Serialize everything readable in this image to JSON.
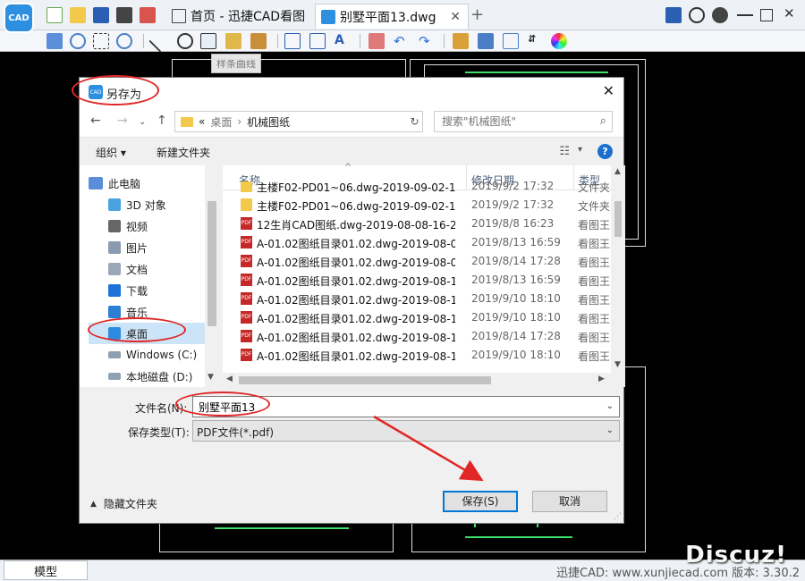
{
  "app": {
    "logo_text": "CAD",
    "tabs": [
      {
        "label": "首页 - 迅捷CAD看图"
      },
      {
        "label": "别墅平面13.dwg"
      }
    ],
    "tab_close": "✕",
    "tab_add": "+",
    "tooltip": "样条曲线"
  },
  "dialog": {
    "title": "另存为",
    "close": "✕",
    "breadcrumb": [
      "«",
      "桌面",
      "机械图纸"
    ],
    "search_placeholder": "搜索\"机械图纸\"",
    "organize": "组织 ▾",
    "new_folder": "新建文件夹",
    "help": "?",
    "nav_items": [
      {
        "label": "此电脑",
        "icon": "computer-icon",
        "color": "#5a8ed8"
      },
      {
        "label": "3D 对象",
        "icon": "cube-icon",
        "color": "#4aa3df"
      },
      {
        "label": "视频",
        "icon": "video-icon",
        "color": "#666666"
      },
      {
        "label": "图片",
        "icon": "picture-icon",
        "color": "#8a9bb0"
      },
      {
        "label": "文档",
        "icon": "document-icon",
        "color": "#9aa7b6"
      },
      {
        "label": "下载",
        "icon": "download-icon",
        "color": "#1e73d8"
      },
      {
        "label": "音乐",
        "icon": "music-icon",
        "color": "#2d7fd6"
      },
      {
        "label": "桌面",
        "icon": "desktop-icon",
        "color": "#2d8ce0",
        "selected": true
      },
      {
        "label": "Windows (C:)",
        "icon": "drive-icon",
        "color": "#8fa0b2"
      },
      {
        "label": "本地磁盘 (D:)",
        "icon": "drive-icon",
        "color": "#8fa0b2"
      }
    ],
    "columns": [
      "名称",
      "修改日期",
      "类型"
    ],
    "files": [
      {
        "name": "主楼F02-PD01~06.dwg-2019-09-02-1...",
        "date": "2019/9/2 17:32",
        "type": "文件夹",
        "kind": "folder"
      },
      {
        "name": "主楼F02-PD01~06.dwg-2019-09-02-1...",
        "date": "2019/9/2 17:32",
        "type": "文件夹",
        "kind": "folder"
      },
      {
        "name": "12生肖CAD图纸.dwg-2019-08-08-16-2...",
        "date": "2019/8/8 16:23",
        "type": "看图王",
        "kind": "pdf"
      },
      {
        "name": "A-01.02图纸目录01.02.dwg-2019-08-0...",
        "date": "2019/8/13 16:59",
        "type": "看图王",
        "kind": "pdf"
      },
      {
        "name": "A-01.02图纸目录01.02.dwg-2019-08-0...",
        "date": "2019/8/14 17:28",
        "type": "看图王",
        "kind": "pdf"
      },
      {
        "name": "A-01.02图纸目录01.02.dwg-2019-08-1...",
        "date": "2019/8/13 16:59",
        "type": "看图王",
        "kind": "pdf"
      },
      {
        "name": "A-01.02图纸目录01.02.dwg-2019-08-1...",
        "date": "2019/9/10 18:10",
        "type": "看图王",
        "kind": "pdf"
      },
      {
        "name": "A-01.02图纸目录01.02.dwg-2019-08-1...",
        "date": "2019/9/10 18:10",
        "type": "看图王",
        "kind": "pdf"
      },
      {
        "name": "A-01.02图纸目录01.02.dwg-2019-08-1...",
        "date": "2019/8/14 17:28",
        "type": "看图王",
        "kind": "pdf"
      },
      {
        "name": "A-01.02图纸目录01.02.dwg-2019-08-1...",
        "date": "2019/9/10 18:10",
        "type": "看图王",
        "kind": "pdf"
      }
    ],
    "filename_label": "文件名(N):",
    "filename_value": "别墅平面13",
    "filetype_label": "保存类型(T):",
    "filetype_value": "PDF文件(*.pdf)",
    "hide_folders": "隐藏文件夹",
    "save": "保存(S)",
    "cancel": "取消"
  },
  "status": {
    "model_tab": "模型",
    "site_text": "迅捷CAD: www.xunjiecad.com 版本: 3.30.2",
    "watermark": "Discuz!"
  },
  "colors": {
    "annotation": "#e02626",
    "accent": "#0078d7",
    "cad_green": "#3fe06a"
  }
}
